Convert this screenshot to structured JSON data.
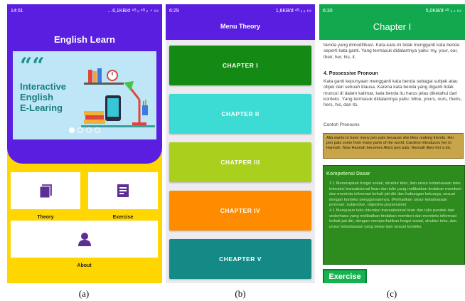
{
  "phone_a": {
    "status": {
      "time": "14:01",
      "right": "…6,1KB/d ⁴ᴳ ᵢₗ ⁴ᴳ ᵢₗ ◔ ▭"
    },
    "title": "English Learn",
    "banner": {
      "quote": "““",
      "lines": [
        "Interactive",
        "English",
        "E-Learing"
      ]
    },
    "carousel": {
      "count": 4,
      "active": 0
    },
    "tiles": {
      "theory": "Theory",
      "exercise": "Exercise",
      "about": "About"
    },
    "colors": {
      "primary": "#5a1ee0",
      "background": "#ffd600"
    }
  },
  "phone_b": {
    "status": {
      "time": "6:29",
      "right": "1,6KB/d ⁴ᴳ ᵢₗ ᵢₗ ▭"
    },
    "title": "Menu Theory",
    "chapters": [
      {
        "label": "CHAPTER I",
        "color": "#138a13"
      },
      {
        "label": "CHAPTER II",
        "color": "#3cdcd5"
      },
      {
        "label": "CHATPER III",
        "color": "#a8d01c"
      },
      {
        "label": "CHAPTER IV",
        "color": "#ff8c00"
      },
      {
        "label": "CHEAPTER V",
        "color": "#148a87"
      }
    ]
  },
  "phone_c": {
    "status": {
      "time": "6:30",
      "right": "5,0KB/d ⁴ᴳ ᵢₗ ᵢₗ ▭"
    },
    "title": "Chapter I",
    "para1": "benda yang dimodifikasi. Kata-kata ini tidak mengganti kata benda seperti kata ganti. Yang termasuk didalamnya yaitu: my, your, our, their, her, his, it.",
    "heading": "4. Possessive Pronoun",
    "para2": "Kata ganti kepunyaan mengganti kata benda sebagai subjek atau objek dari sebuah klausa. Karena kata benda yang diganti tidak muncul di dalam kalimat, kata benda itu harus jelas diketahui dari konteks. Yang termasuk didalamnya yaitu: Mine, yours, ours, theirs, hers, his, dan its.",
    "example_label": "Contoh Pronouns",
    "example": "Alia wants to have many pen pals because she likes making friends. Her pen pals come from many parts of the world. Caroline introduces her to Hannah. Now Hannah becomes Alia's pen pals. Hannah likes her a lot.",
    "kompetensi_title": "Kompetensi Dasar",
    "kompetensi_body": "3.1 Menerapkan fungsi sosial, struktur teks, dan unsur kebahasaan teks interaksi transaksional lisan dan tulis yang melibatkan tindakan memberi dan meminta informasi terkait jati diri dan hubungan keluarga, sesuai dengan konteks penggunaannya. (Perhatikan unsur kebahasaan pronoun: subjective, objective,possessive)\n4.1 Menyusun teks interaksi transaksional lisan dan tulis pendek dan sederhana yang melibatkan tindakan memberi dan meminta informasi terkait jati diri, dengan memperhatikan fungsi sosial, struktur teks, dan unsur kebahasaan yang benar dan sesuai konteks",
    "exercise_button": "Exercise"
  },
  "captions": [
    "(a)",
    "(b)",
    "(c)"
  ]
}
